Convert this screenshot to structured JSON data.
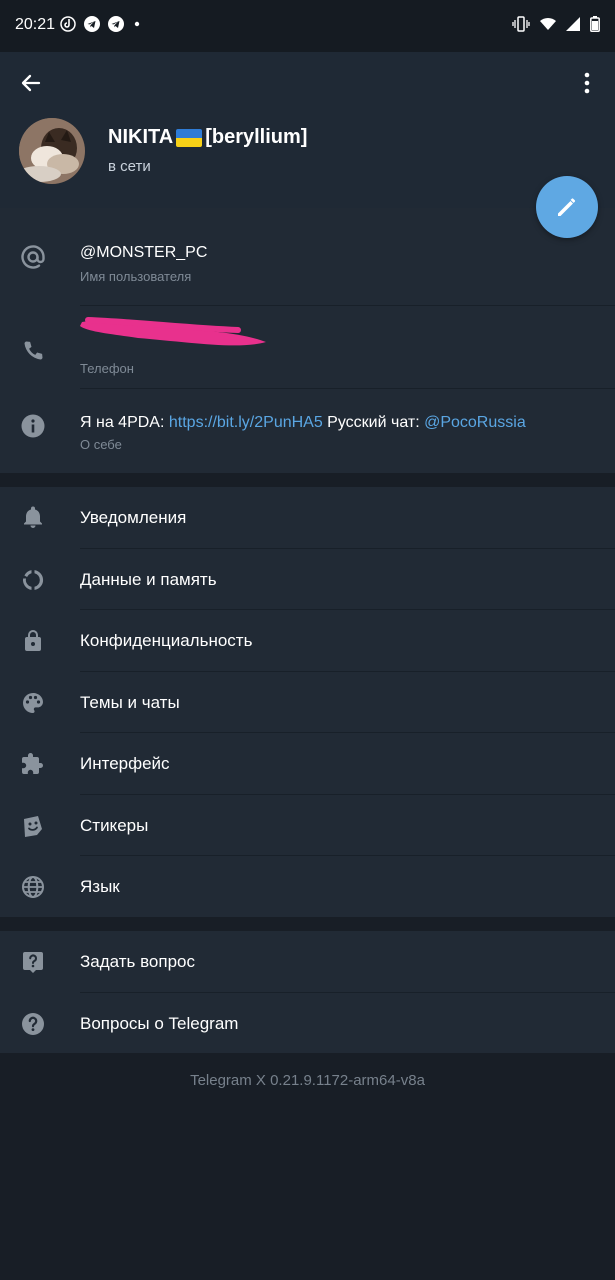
{
  "status_bar": {
    "time": "20:21"
  },
  "profile": {
    "name_before_flag": "NIKITA",
    "name_after_flag": "[beryllium]",
    "status": "в сети"
  },
  "info": {
    "username": {
      "value": "@MONSTER_PC",
      "label": "Имя пользователя"
    },
    "phone": {
      "label": "Телефон"
    },
    "bio": {
      "prefix": "Я на 4PDA: ",
      "link1": "https://bit.ly/2PunHA5",
      "middle": " Русский чат: ",
      "link2": "@PocoRussia",
      "label": "О себе"
    }
  },
  "settings_menu": [
    {
      "label": "Уведомления",
      "icon": "bell-icon"
    },
    {
      "label": "Данные и память",
      "icon": "data-usage-icon"
    },
    {
      "label": "Конфиденциальность",
      "icon": "lock-icon"
    },
    {
      "label": "Темы и чаты",
      "icon": "palette-icon"
    },
    {
      "label": "Интерфейс",
      "icon": "puzzle-icon"
    },
    {
      "label": "Стикеры",
      "icon": "sticker-icon"
    },
    {
      "label": "Язык",
      "icon": "globe-icon"
    }
  ],
  "help_menu": [
    {
      "label": "Задать вопрос",
      "icon": "question-bubble-icon"
    },
    {
      "label": "Вопросы о Telegram",
      "icon": "help-circle-icon"
    }
  ],
  "version": "Telegram X 0.21.9.1172-arm64-v8a",
  "colors": {
    "background": "#181e26",
    "header": "#1f2935",
    "section": "#212a35",
    "accent": "#5fa8e3",
    "link": "#5aa6e3",
    "redaction": "#e8318d"
  }
}
